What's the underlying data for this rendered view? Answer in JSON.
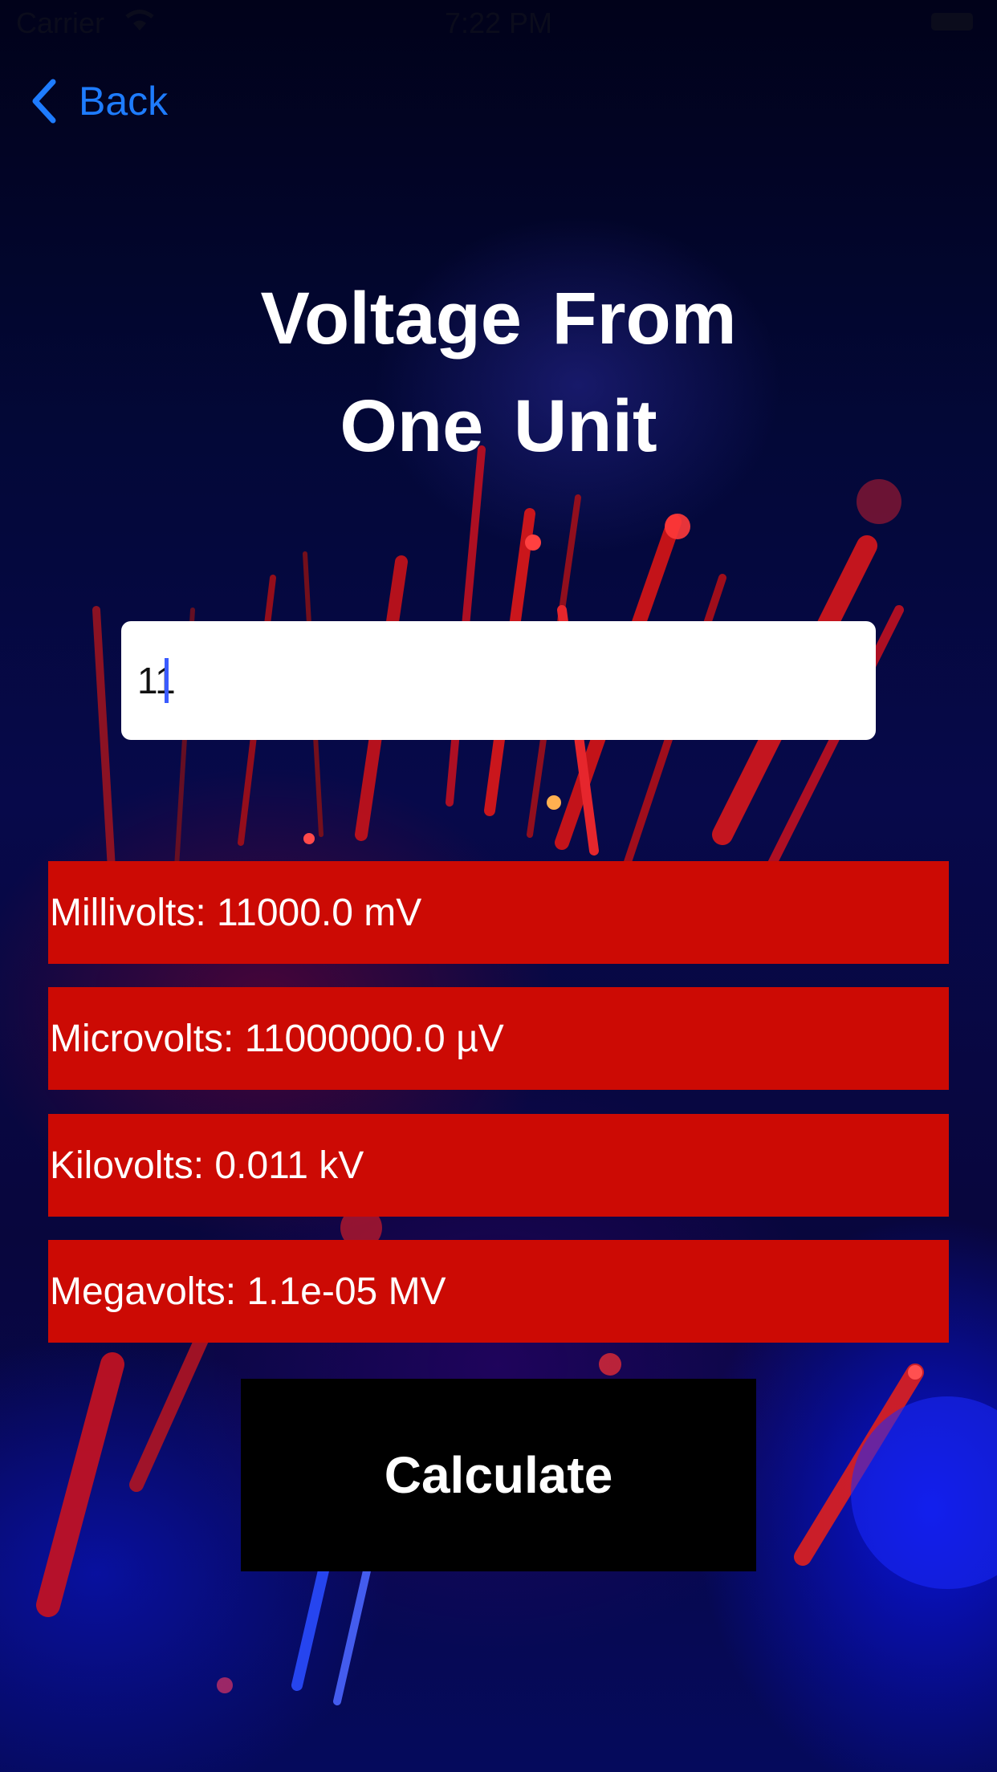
{
  "status_bar": {
    "carrier": "Carrier",
    "time": "7:22 PM"
  },
  "nav": {
    "back_label": "Back"
  },
  "title": {
    "line1": "Voltage From",
    "line2": "One Unit"
  },
  "input": {
    "value": "11"
  },
  "results": [
    {
      "text": "Millivolts: 11000.0 mV"
    },
    {
      "text": "Microvolts: 11000000.0 µV"
    },
    {
      "text": "Kilovolts: 0.011 kV"
    },
    {
      "text": "Megavolts: 1.1e-05 MV"
    }
  ],
  "actions": {
    "calculate_label": "Calculate"
  },
  "colors": {
    "accent_blue": "#1e7cff",
    "result_red": "#cc0a04",
    "button_black": "#000000"
  }
}
